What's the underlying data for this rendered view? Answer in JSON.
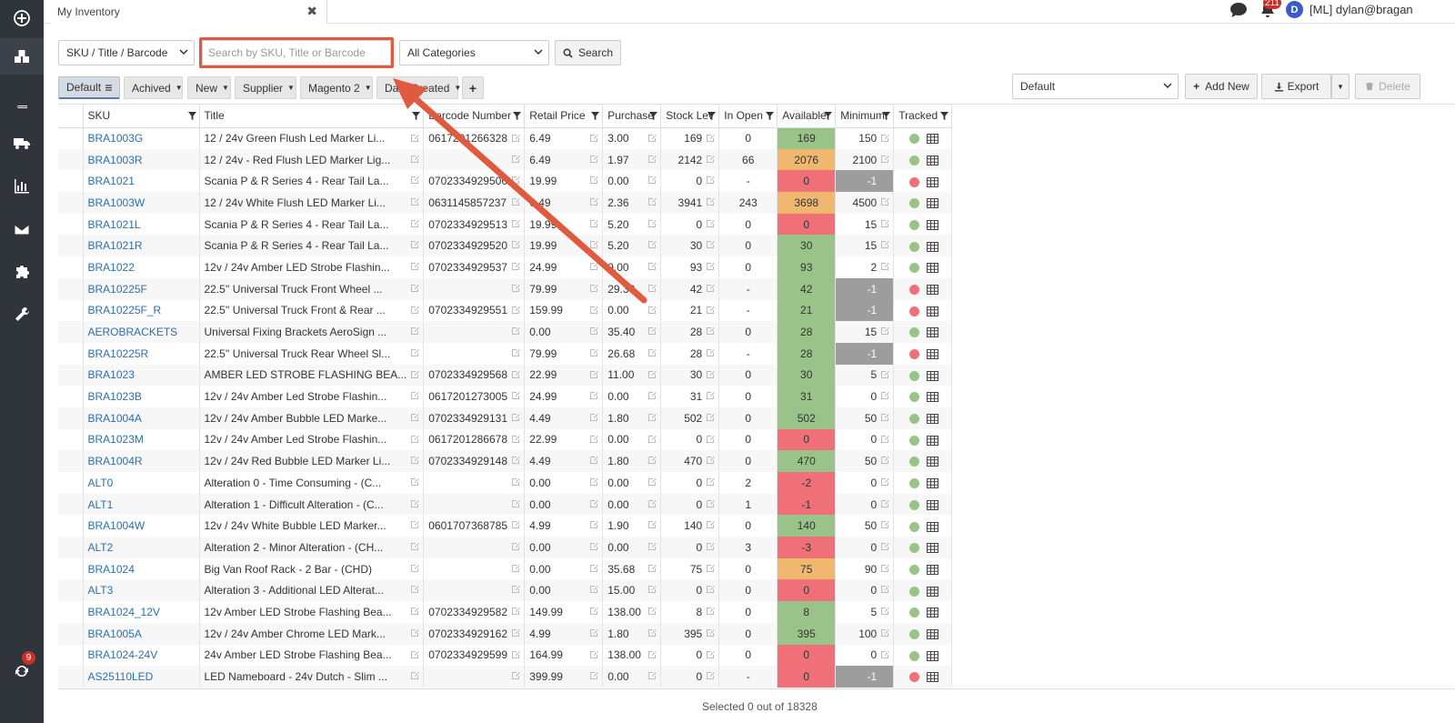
{
  "tab": {
    "title": "My Inventory",
    "close": "✖"
  },
  "user": {
    "avatar_letter": "D",
    "name": "[ML] dylan@bragan",
    "notifications": "211"
  },
  "sidebar": {
    "sync_badge": "9"
  },
  "search": {
    "field_select": "SKU / Title / Barcode",
    "placeholder": "Search by SKU, Title or Barcode",
    "category_select": "All Categories",
    "button": "Search"
  },
  "filters": {
    "default": "Default",
    "archived": "Achived",
    "new": "New",
    "supplier": "Supplier",
    "magento": "Magento 2",
    "date_created": "Date Created",
    "plus": "+"
  },
  "actions": {
    "view_select": "Default",
    "add_new": "Add New",
    "export": "Export",
    "delete": "Delete"
  },
  "columns": [
    "SKU",
    "Title",
    "Barcode Number",
    "Retail Price",
    "Purchase",
    "Stock Lev",
    "In Open",
    "Available",
    "Minimum",
    "Tracked"
  ],
  "rows": [
    {
      "sku": "BRA1003G",
      "title": "12 / 24v Green Flush Led Marker Li...",
      "barcode": "0617201266328",
      "retail": "6.49",
      "purchase": "3.00",
      "stock": "169",
      "open": "0",
      "avail": "169",
      "avail_status": "green",
      "min": "150",
      "min_status": "normal",
      "tracked": "green"
    },
    {
      "sku": "BRA1003R",
      "title": "12 / 24v - Red Flush LED Marker Lig...",
      "barcode": "",
      "retail": "6.49",
      "purchase": "1.97",
      "stock": "2142",
      "open": "66",
      "avail": "2076",
      "avail_status": "orange",
      "min": "2100",
      "min_status": "normal",
      "tracked": "green"
    },
    {
      "sku": "BRA1021",
      "title": "Scania P & R Series 4 - Rear Tail La...",
      "barcode": "0702334929506",
      "retail": "19.99",
      "purchase": "0.00",
      "stock": "0",
      "open": "-",
      "avail": "0",
      "avail_status": "red",
      "min": "-1",
      "min_status": "grey",
      "tracked": "red"
    },
    {
      "sku": "BRA1003W",
      "title": "12 / 24v White Flush LED Marker Li...",
      "barcode": "0631145857237",
      "retail": "6.49",
      "purchase": "2.36",
      "stock": "3941",
      "open": "243",
      "avail": "3698",
      "avail_status": "orange",
      "min": "4500",
      "min_status": "normal",
      "tracked": "green"
    },
    {
      "sku": "BRA1021L",
      "title": "Scania P & R Series 4 - Rear Tail La...",
      "barcode": "0702334929513",
      "retail": "19.99",
      "purchase": "5.20",
      "stock": "0",
      "open": "0",
      "avail": "0",
      "avail_status": "red",
      "min": "15",
      "min_status": "normal",
      "tracked": "green"
    },
    {
      "sku": "BRA1021R",
      "title": "Scania P & R Series 4 - Rear Tail La...",
      "barcode": "0702334929520",
      "retail": "19.99",
      "purchase": "5.20",
      "stock": "30",
      "open": "0",
      "avail": "30",
      "avail_status": "green",
      "min": "15",
      "min_status": "normal",
      "tracked": "green"
    },
    {
      "sku": "BRA1022",
      "title": "12v / 24v Amber LED Strobe Flashin...",
      "barcode": "0702334929537",
      "retail": "24.99",
      "purchase": "9.00",
      "stock": "93",
      "open": "0",
      "avail": "93",
      "avail_status": "green",
      "min": "2",
      "min_status": "normal",
      "tracked": "green"
    },
    {
      "sku": "BRA10225F",
      "title": "22.5'' Universal Truck Front Wheel ...",
      "barcode": "",
      "retail": "79.99",
      "purchase": "29.39",
      "stock": "42",
      "open": "-",
      "avail": "42",
      "avail_status": "green",
      "min": "-1",
      "min_status": "grey",
      "tracked": "red"
    },
    {
      "sku": "BRA10225F_R",
      "title": "22.5'' Universal Truck Front & Rear ...",
      "barcode": "0702334929551",
      "retail": "159.99",
      "purchase": "0.00",
      "stock": "21",
      "open": "-",
      "avail": "21",
      "avail_status": "green",
      "min": "-1",
      "min_status": "grey",
      "tracked": "red"
    },
    {
      "sku": "AEROBRACKETS",
      "title": "Universal Fixing Brackets AeroSign ...",
      "barcode": "",
      "retail": "0.00",
      "purchase": "35.40",
      "stock": "28",
      "open": "0",
      "avail": "28",
      "avail_status": "green",
      "min": "15",
      "min_status": "normal",
      "tracked": "green"
    },
    {
      "sku": "BRA10225R",
      "title": "22.5'' Universal Truck Rear Wheel Sl...",
      "barcode": "",
      "retail": "79.99",
      "purchase": "26.68",
      "stock": "28",
      "open": "-",
      "avail": "28",
      "avail_status": "green",
      "min": "-1",
      "min_status": "grey",
      "tracked": "red"
    },
    {
      "sku": "BRA1023",
      "title": "AMBER LED STROBE FLASHING BEA...",
      "barcode": "0702334929568",
      "retail": "22.99",
      "purchase": "11.00",
      "stock": "30",
      "open": "0",
      "avail": "30",
      "avail_status": "green",
      "min": "5",
      "min_status": "normal",
      "tracked": "green"
    },
    {
      "sku": "BRA1023B",
      "title": "12v / 24v Amber Led Strobe Flashin...",
      "barcode": "0617201273005",
      "retail": "24.99",
      "purchase": "0.00",
      "stock": "31",
      "open": "0",
      "avail": "31",
      "avail_status": "green",
      "min": "0",
      "min_status": "normal",
      "tracked": "green"
    },
    {
      "sku": "BRA1004A",
      "title": "12v / 24v Amber Bubble LED Marke...",
      "barcode": "0702334929131",
      "retail": "4.49",
      "purchase": "1.80",
      "stock": "502",
      "open": "0",
      "avail": "502",
      "avail_status": "green",
      "min": "50",
      "min_status": "normal",
      "tracked": "green"
    },
    {
      "sku": "BRA1023M",
      "title": "12v / 24v Amber Led Strobe Flashin...",
      "barcode": "0617201286678",
      "retail": "22.99",
      "purchase": "0.00",
      "stock": "0",
      "open": "0",
      "avail": "0",
      "avail_status": "red",
      "min": "0",
      "min_status": "normal",
      "tracked": "green"
    },
    {
      "sku": "BRA1004R",
      "title": "12v / 24v Red Bubble LED Marker Li...",
      "barcode": "0702334929148",
      "retail": "4.49",
      "purchase": "1.80",
      "stock": "470",
      "open": "0",
      "avail": "470",
      "avail_status": "green",
      "min": "50",
      "min_status": "normal",
      "tracked": "green"
    },
    {
      "sku": "ALT0",
      "title": "Alteration 0 - Time Consuming - (C...",
      "barcode": "",
      "retail": "0.00",
      "purchase": "0.00",
      "stock": "0",
      "open": "2",
      "avail": "-2",
      "avail_status": "red",
      "min": "0",
      "min_status": "normal",
      "tracked": "green"
    },
    {
      "sku": "ALT1",
      "title": "Alteration 1 - Difficult Alteration - (C...",
      "barcode": "",
      "retail": "0.00",
      "purchase": "0.00",
      "stock": "0",
      "open": "1",
      "avail": "-1",
      "avail_status": "red",
      "min": "0",
      "min_status": "normal",
      "tracked": "green"
    },
    {
      "sku": "BRA1004W",
      "title": "12v / 24v White Bubble LED Marker...",
      "barcode": "0601707368785",
      "retail": "4.99",
      "purchase": "1.90",
      "stock": "140",
      "open": "0",
      "avail": "140",
      "avail_status": "green",
      "min": "50",
      "min_status": "normal",
      "tracked": "green"
    },
    {
      "sku": "ALT2",
      "title": "Alteration 2 - Minor Alteration - (CH...",
      "barcode": "",
      "retail": "0.00",
      "purchase": "0.00",
      "stock": "0",
      "open": "3",
      "avail": "-3",
      "avail_status": "red",
      "min": "0",
      "min_status": "normal",
      "tracked": "green"
    },
    {
      "sku": "BRA1024",
      "title": "Big Van Roof Rack - 2 Bar - (CHD)",
      "barcode": "",
      "retail": "0.00",
      "purchase": "35.68",
      "stock": "75",
      "open": "0",
      "avail": "75",
      "avail_status": "orange",
      "min": "90",
      "min_status": "normal",
      "tracked": "green"
    },
    {
      "sku": "ALT3",
      "title": "Alteration 3 - Additional LED Alterat...",
      "barcode": "",
      "retail": "0.00",
      "purchase": "15.00",
      "stock": "0",
      "open": "0",
      "avail": "0",
      "avail_status": "red",
      "min": "0",
      "min_status": "normal",
      "tracked": "green"
    },
    {
      "sku": "BRA1024_12V",
      "title": "12v Amber LED Strobe Flashing Bea...",
      "barcode": "0702334929582",
      "retail": "149.99",
      "purchase": "138.00",
      "stock": "8",
      "open": "0",
      "avail": "8",
      "avail_status": "green",
      "min": "5",
      "min_status": "normal",
      "tracked": "green"
    },
    {
      "sku": "BRA1005A",
      "title": "12v / 24v Amber Chrome LED Mark...",
      "barcode": "0702334929162",
      "retail": "4.99",
      "purchase": "1.80",
      "stock": "395",
      "open": "0",
      "avail": "395",
      "avail_status": "green",
      "min": "100",
      "min_status": "normal",
      "tracked": "green"
    },
    {
      "sku": "BRA1024-24V",
      "title": "24v Amber LED Strobe Flashing Bea...",
      "barcode": "0702334929599",
      "retail": "164.99",
      "purchase": "138.00",
      "stock": "0",
      "open": "0",
      "avail": "0",
      "avail_status": "red",
      "min": "0",
      "min_status": "normal",
      "tracked": "green"
    },
    {
      "sku": "AS25110LED",
      "title": "LED Nameboard - 24v Dutch - Slim ...",
      "barcode": "",
      "retail": "399.99",
      "purchase": "0.00",
      "stock": "0",
      "open": "-",
      "avail": "0",
      "avail_status": "red",
      "min": "-1",
      "min_status": "grey",
      "tracked": "red"
    }
  ],
  "footer": {
    "selection": "Selected 0 out of 18328"
  }
}
